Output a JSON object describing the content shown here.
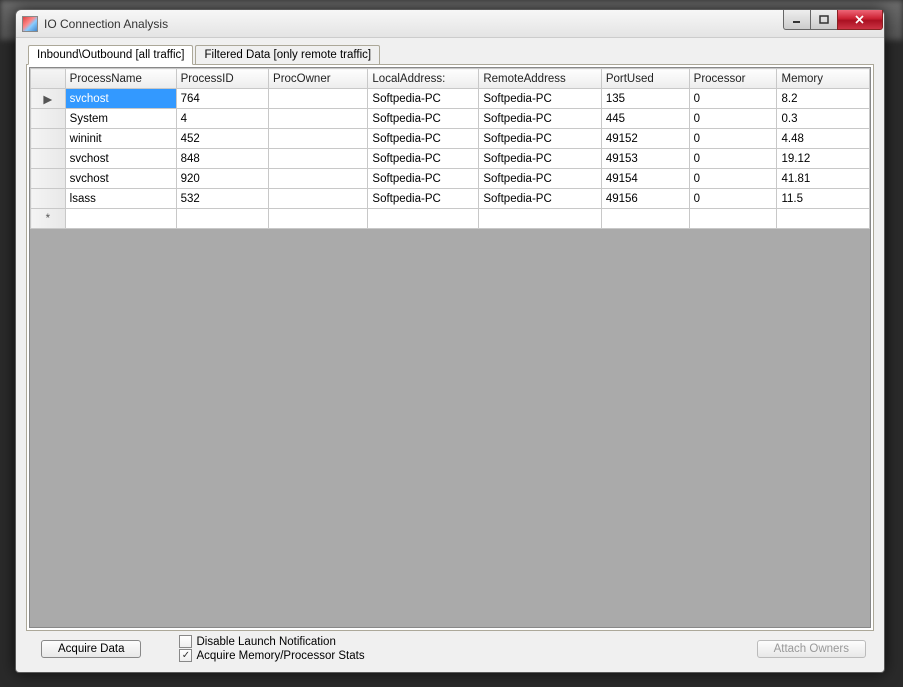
{
  "window": {
    "title": "IO Connection Analysis"
  },
  "tabs": [
    {
      "label": "Inbound\\Outbound [all traffic]"
    },
    {
      "label": "Filtered Data [only remote traffic]"
    }
  ],
  "grid": {
    "columns": [
      "ProcessName",
      "ProcessID",
      "ProcOwner",
      "LocalAddress:",
      "RemoteAddress",
      "PortUsed",
      "Processor",
      "Memory"
    ],
    "rows": [
      {
        "ProcessName": "svchost",
        "ProcessID": "764",
        "ProcOwner": "",
        "LocalAddress": "Softpedia-PC",
        "RemoteAddress": "Softpedia-PC",
        "PortUsed": "135",
        "Processor": "0",
        "Memory": "8.2",
        "selected": true
      },
      {
        "ProcessName": "System",
        "ProcessID": "4",
        "ProcOwner": "",
        "LocalAddress": "Softpedia-PC",
        "RemoteAddress": "Softpedia-PC",
        "PortUsed": "445",
        "Processor": "0",
        "Memory": "0.3"
      },
      {
        "ProcessName": "wininit",
        "ProcessID": "452",
        "ProcOwner": "",
        "LocalAddress": "Softpedia-PC",
        "RemoteAddress": "Softpedia-PC",
        "PortUsed": "49152",
        "Processor": "0",
        "Memory": "4.48"
      },
      {
        "ProcessName": "svchost",
        "ProcessID": "848",
        "ProcOwner": "",
        "LocalAddress": "Softpedia-PC",
        "RemoteAddress": "Softpedia-PC",
        "PortUsed": "49153",
        "Processor": "0",
        "Memory": "19.12"
      },
      {
        "ProcessName": "svchost",
        "ProcessID": "920",
        "ProcOwner": "",
        "LocalAddress": "Softpedia-PC",
        "RemoteAddress": "Softpedia-PC",
        "PortUsed": "49154",
        "Processor": "0",
        "Memory": "41.81"
      },
      {
        "ProcessName": "lsass",
        "ProcessID": "532",
        "ProcOwner": "",
        "LocalAddress": "Softpedia-PC",
        "RemoteAddress": "Softpedia-PC",
        "PortUsed": "49156",
        "Processor": "0",
        "Memory": "11.5"
      }
    ]
  },
  "bottom": {
    "acquire_label": "Acquire Data",
    "chk_disable_label": "Disable Launch Notification",
    "chk_disable_checked": false,
    "chk_acquire_label": "Acquire Memory/Processor Stats",
    "chk_acquire_checked": true,
    "attach_label": "Attach Owners"
  }
}
